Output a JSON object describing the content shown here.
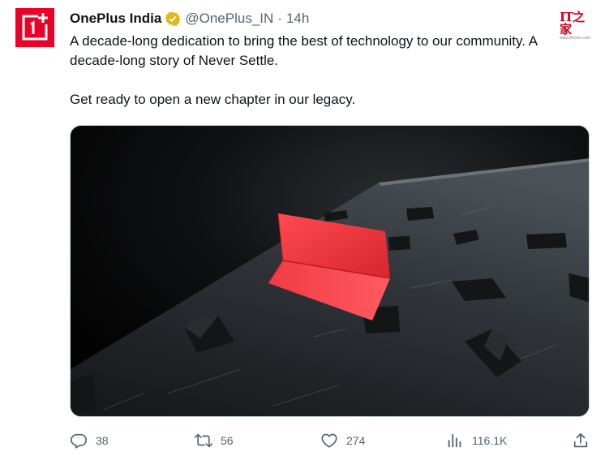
{
  "tweet": {
    "author": {
      "display_name": "OnePlus India",
      "handle": "@OnePlus_IN",
      "verified_icon": "verified-gold-badge",
      "avatar_logo": "1+",
      "avatar_color": "#eb0028"
    },
    "separator": "·",
    "time": "14h",
    "text": {
      "paragraph1": "A decade-long dedication to bring the best of technology to our community. A decade-long story of Never Settle.",
      "paragraph2": "Get ready to open a new chapter in our legacy."
    },
    "media": {
      "icon": "video-still-image"
    },
    "actions": {
      "reply": {
        "icon": "reply-icon",
        "count": "38"
      },
      "retweet": {
        "icon": "retweet-icon",
        "count": "56"
      },
      "like": {
        "icon": "heart-icon",
        "count": "274"
      },
      "views": {
        "icon": "views-icon",
        "count": "116.1K"
      },
      "share": {
        "icon": "share-icon"
      }
    }
  },
  "watermark": {
    "logo": "IT之家",
    "url": "www.ithome.com"
  },
  "colors": {
    "text": "#0f1419",
    "secondary": "#536471",
    "verified": "#e2b719",
    "accent_red": "#eb0028",
    "paper_red": "#f0404a"
  }
}
